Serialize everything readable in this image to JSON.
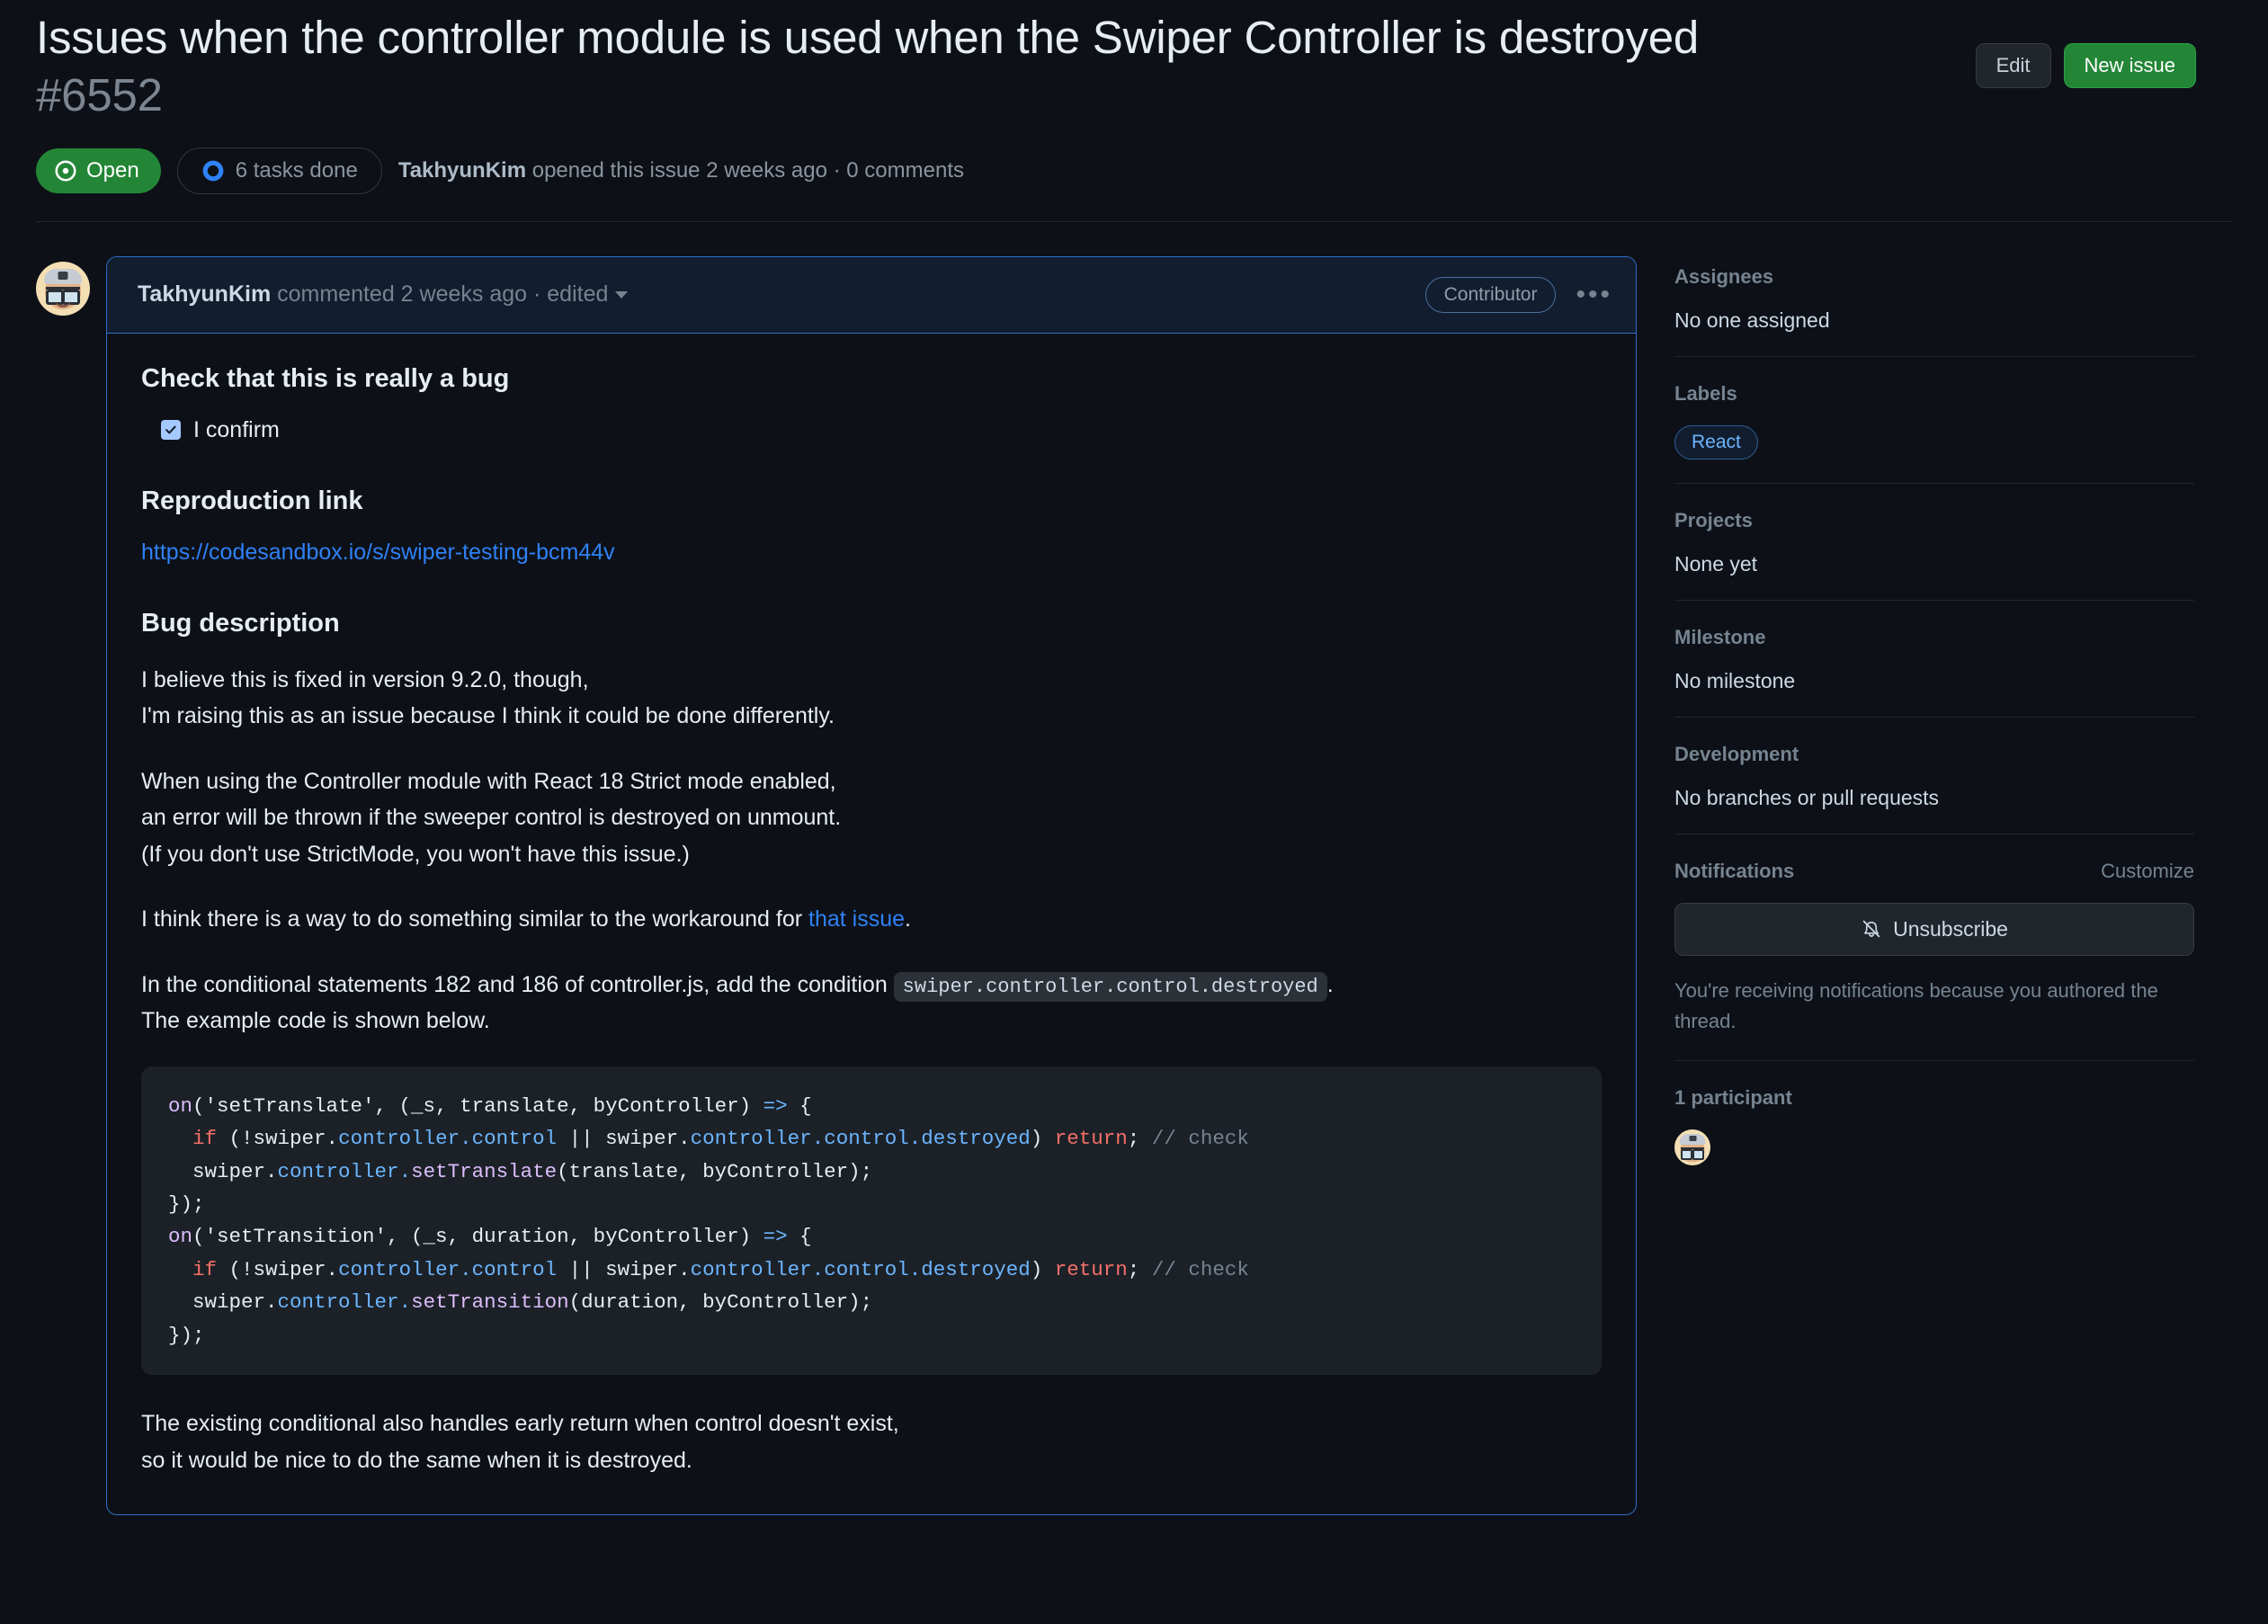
{
  "header": {
    "title": "Issues when the controller module is used when the Swiper Controller is destroyed",
    "issue_number": "#6552",
    "edit_label": "Edit",
    "new_issue_label": "New issue",
    "state_label": "Open",
    "tasks_label": "6 tasks done",
    "author": "TakhyunKim",
    "meta_suffix": " opened this issue 2 weeks ago · 0 comments"
  },
  "comment": {
    "author": "TakhyunKim",
    "meta": " commented 2 weeks ago · edited",
    "badge": "Contributor",
    "menu_icon": "•••",
    "heading_check": "Check that this is really a bug",
    "confirm_label": "I confirm",
    "heading_repro": "Reproduction link",
    "repro_url": "https://codesandbox.io/s/swiper-testing-bcm44v",
    "heading_bug": "Bug description",
    "p1_line1": "I believe this is fixed in version 9.2.0, though,",
    "p1_line2": "I'm raising this as an issue because I think it could be done differently.",
    "p2_line1": "When using the Controller module with React 18 Strict mode enabled,",
    "p2_line2": "an error will be thrown if the sweeper control is destroyed on unmount.",
    "p2_line3": "(If you don't use StrictMode, you won't have this issue.)",
    "p3_before": "I think there is a way to do something similar to the workaround for ",
    "p3_link": "that issue",
    "p3_after": ".",
    "p4_before": "In the conditional statements 182 and 186 of controller.js, add the condition ",
    "p4_code": "swiper.controller.control.destroyed",
    "p4_after": ".",
    "p4_line2": "The example code is shown below.",
    "code": {
      "l1_fn": "on",
      "l1_rest": "('setTranslate', (_s, translate, byController) ",
      "l1_arrow": "=>",
      "l1_brace": " {",
      "l2_kw": "if",
      "l2_a": " (!swiper.",
      "l2_p1": "controller",
      "l2_b": ".",
      "l2_p2": "control",
      "l2_c": " || swiper.",
      "l2_p3": "controller",
      "l2_d": ".",
      "l2_p4": "control",
      "l2_e": ".",
      "l2_p5": "destroyed",
      "l2_f": ") ",
      "l2_ret": "return",
      "l2_g": "; ",
      "l2_com": "// check",
      "l3_a": "swiper.",
      "l3_p1": "controller",
      "l3_b": ".",
      "l3_fn": "setTranslate",
      "l3_c": "(translate, byController);",
      "l4": "});",
      "l5_fn": "on",
      "l5_rest": "('setTransition', (_s, duration, byController) ",
      "l5_arrow": "=>",
      "l5_brace": " {",
      "l7_fn": "setTransition",
      "l7_c": "(duration, byController);"
    },
    "p5_line1": "The existing conditional also handles early return when control doesn't exist,",
    "p5_line2": "so it would be nice to do the same when it is destroyed."
  },
  "sidebar": {
    "assignees_title": "Assignees",
    "assignees_value": "No one assigned",
    "labels_title": "Labels",
    "label_react": "React",
    "projects_title": "Projects",
    "projects_value": "None yet",
    "milestone_title": "Milestone",
    "milestone_value": "No milestone",
    "development_title": "Development",
    "development_value": "No branches or pull requests",
    "notifications_title": "Notifications",
    "customize_label": "Customize",
    "unsubscribe_label": "Unsubscribe",
    "notif_note": "You're receiving notifications because you authored the thread.",
    "participants_title": "1 participant"
  }
}
